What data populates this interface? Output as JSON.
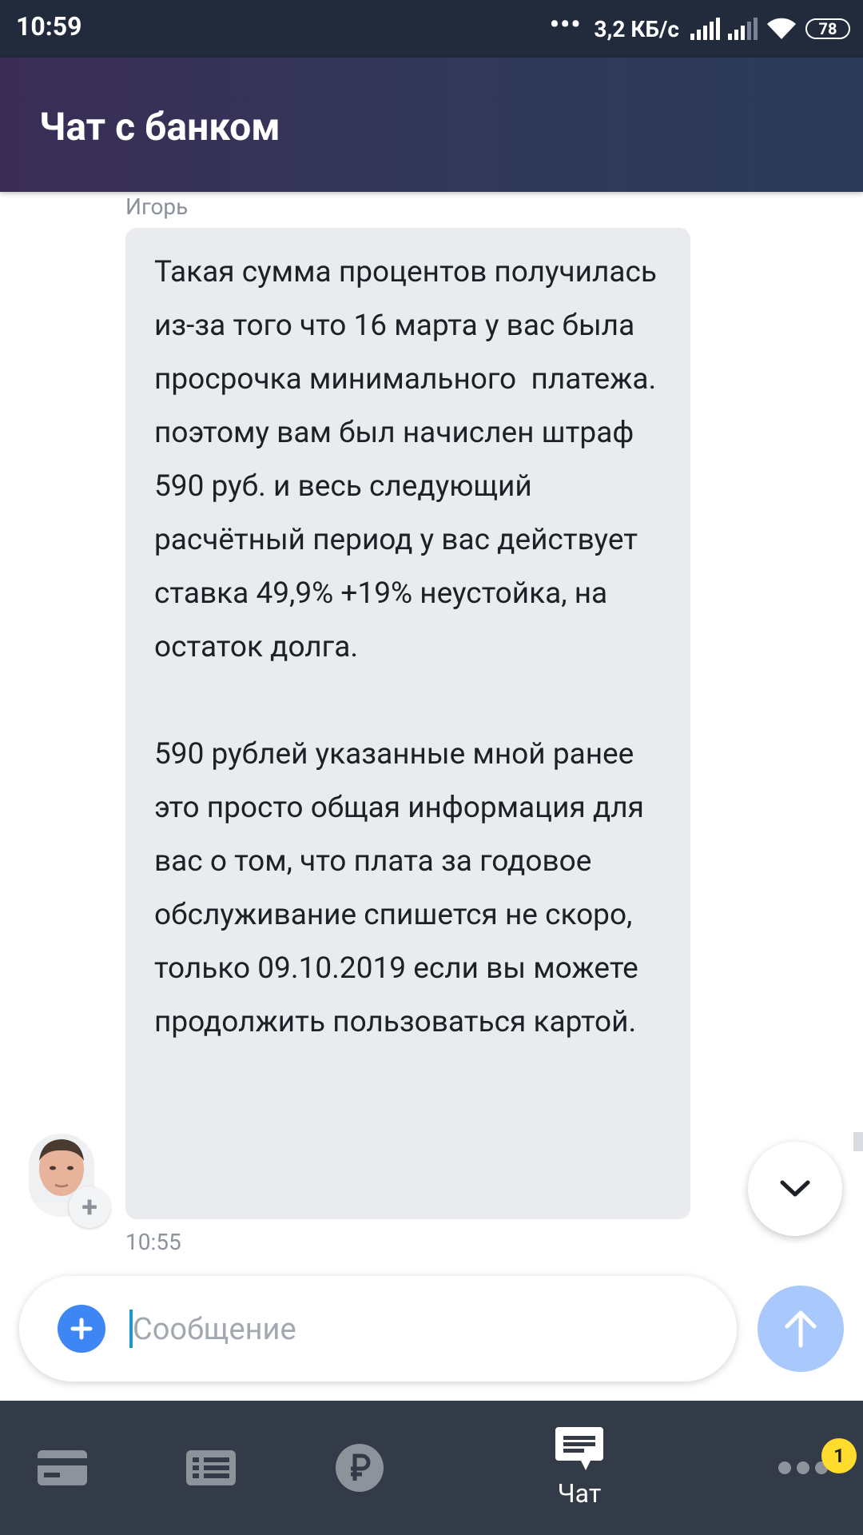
{
  "status_bar": {
    "time": "10:59",
    "dots": "•••",
    "speed": "3,2 КБ/с",
    "battery": "78"
  },
  "header": {
    "title": "Чат с банком"
  },
  "message": {
    "sender": "Игорь",
    "text": "Такая сумма процентов получилась из-за того что 16 марта у вас была просрочка минимального  платежа. поэтому вам был начислен штраф 590 руб. и весь следующий расчётный период у вас действует ставка 49,9% +19% неустойка, на остаток долга.\n\n590 рублей указанные мной ранее это просто общая информация для вас о том, что плата за годовое обслуживание спишется не скоро, только 09.10.2019 если вы можете продолжить пользоваться картой.",
    "time": "10:55"
  },
  "composer": {
    "placeholder": "Сообщение",
    "value": ""
  },
  "bottom_nav": {
    "items": [
      {
        "icon": "card-icon",
        "label": ""
      },
      {
        "icon": "list-icon",
        "label": ""
      },
      {
        "icon": "ruble-icon",
        "label": ""
      },
      {
        "icon": "chat-icon",
        "label": "Чат",
        "active": true
      },
      {
        "icon": "more-icon",
        "label": ""
      }
    ],
    "badge": "1"
  },
  "colors": {
    "status_bar": "#212b3c",
    "header_start": "#3a2d55",
    "header_end": "#2b3a58",
    "bubble": "#e9ebee",
    "accent_blue": "#3d86f4",
    "send_disabled": "#a9c8fb",
    "nav_bg": "#333b48",
    "badge": "#ffdc2e"
  }
}
